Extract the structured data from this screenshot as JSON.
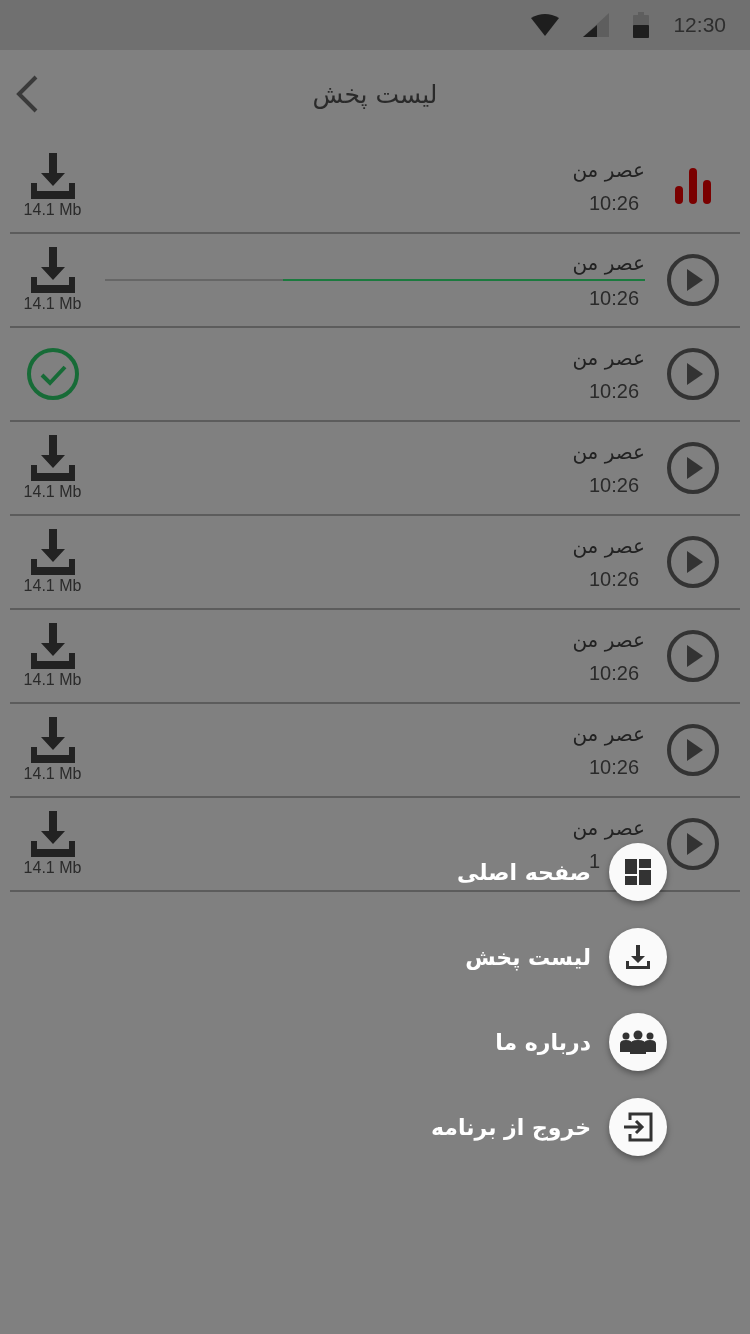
{
  "status_bar": {
    "time": "12:30"
  },
  "header": {
    "title": "لیست پخش"
  },
  "tracks": [
    {
      "title": "عصر من",
      "time": "10:26",
      "playing": true,
      "download": {
        "kind": "download",
        "size": "14.1 Mb"
      }
    },
    {
      "title": "عصر من",
      "time": "10:26",
      "playing": false,
      "progress": {
        "level": 0.67
      },
      "download": {
        "kind": "download",
        "size": "14.1 Mb"
      }
    },
    {
      "title": "عصر من",
      "time": "10:26",
      "playing": false,
      "download": {
        "kind": "done"
      }
    },
    {
      "title": "عصر من",
      "time": "10:26",
      "playing": false,
      "download": {
        "kind": "download",
        "size": "14.1 Mb"
      }
    },
    {
      "title": "عصر من",
      "time": "10:26",
      "playing": false,
      "download": {
        "kind": "download",
        "size": "14.1 Mb"
      }
    },
    {
      "title": "عصر من",
      "time": "10:26",
      "playing": false,
      "download": {
        "kind": "download",
        "size": "14.1 Mb"
      }
    },
    {
      "title": "عصر من",
      "time": "10:26",
      "playing": false,
      "download": {
        "kind": "download",
        "size": "14.1 Mb"
      }
    },
    {
      "title": "عصر من",
      "time": "1",
      "playing": false,
      "download": {
        "kind": "download",
        "size": "14.1 Mb"
      }
    }
  ],
  "menu": [
    {
      "kind": "home",
      "label": "صفحه اصلی"
    },
    {
      "kind": "playlist",
      "label": "لیست پخش"
    },
    {
      "kind": "about",
      "label": "درباره ما"
    },
    {
      "kind": "exit",
      "label": "خروج از برنامه"
    }
  ]
}
